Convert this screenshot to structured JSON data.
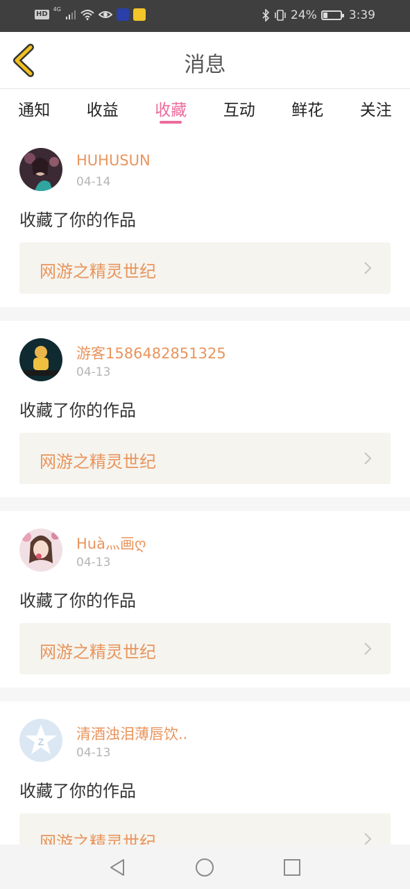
{
  "status_bar": {
    "hd": "HD",
    "network": "4G",
    "battery_percent": "24%",
    "battery_level": 0.24,
    "time": "3:39",
    "icons": [
      "signal-icon",
      "wifi-icon",
      "eye-icon",
      "app-icon",
      "weibo-icon",
      "bluetooth-icon",
      "vibrate-icon",
      "battery-icon"
    ]
  },
  "header": {
    "title": "消息",
    "back_icon": "chevron-left-icon",
    "accent": "#f2c11f"
  },
  "tabs": [
    {
      "label": "通知"
    },
    {
      "label": "收益"
    },
    {
      "label": "收藏",
      "active": true
    },
    {
      "label": "互动"
    },
    {
      "label": "鲜花"
    },
    {
      "label": "关注"
    }
  ],
  "colors": {
    "tab_active": "#ec6b9c",
    "username": "#e9945c",
    "work_title": "#e9945c",
    "work_box_bg": "#f5f4ee",
    "separator": "#f6f6f6"
  },
  "feed": [
    {
      "username": "HUHUSUN",
      "date": "04-14",
      "action": "收藏了你的作品",
      "work_title": "网游之精灵世纪",
      "avatar": "photo-avatar"
    },
    {
      "username": "游客1586482851325",
      "date": "04-13",
      "action": "收藏了你的作品",
      "work_title": "网游之精灵世纪",
      "avatar": "photo-avatar"
    },
    {
      "username": "Huà灬画ღ",
      "date": "04-13",
      "action": "收藏了你的作品",
      "work_title": "网游之精灵世纪",
      "avatar": "photo-avatar"
    },
    {
      "username": "清酒浊泪薄唇饮..",
      "date": "04-13",
      "action": "收藏了你的作品",
      "work_title": "网游之精灵世纪",
      "avatar": "qzone-default-avatar"
    }
  ],
  "nav_bar": {
    "icons": [
      "back-triangle-icon",
      "home-circle-icon",
      "recents-square-icon"
    ]
  }
}
